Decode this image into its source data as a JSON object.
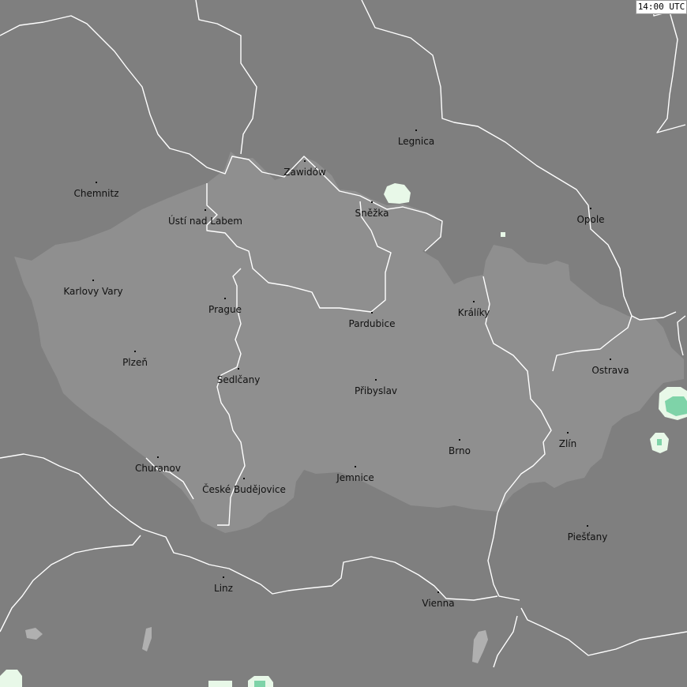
{
  "timestamp": "14:00 UTC",
  "colors": {
    "background": "#7f7f7f",
    "region": "#8f8f8f",
    "lake": "#b0b0b0",
    "border_line": "#ffffff",
    "precip_light": "#e8f8e8",
    "precip_medium": "#7ed3a8"
  },
  "places": [
    {
      "name": "Chemnitz"
    },
    {
      "name": "Zawidów"
    },
    {
      "name": "Legnica"
    },
    {
      "name": "Ústí nad Labem"
    },
    {
      "name": "Sněžka"
    },
    {
      "name": "Opole"
    },
    {
      "name": "Karlovy Vary"
    },
    {
      "name": "Prague"
    },
    {
      "name": "Pardubice"
    },
    {
      "name": "Králíky"
    },
    {
      "name": "Plzeň"
    },
    {
      "name": "Ostrava"
    },
    {
      "name": "Sedlčany"
    },
    {
      "name": "Přibyslav"
    },
    {
      "name": "Zlín"
    },
    {
      "name": "Brno"
    },
    {
      "name": "Churanov"
    },
    {
      "name": "České Budějovice"
    },
    {
      "name": "Jemnice"
    },
    {
      "name": "Piešťany"
    },
    {
      "name": "Linz"
    },
    {
      "name": "Vienna"
    }
  ]
}
